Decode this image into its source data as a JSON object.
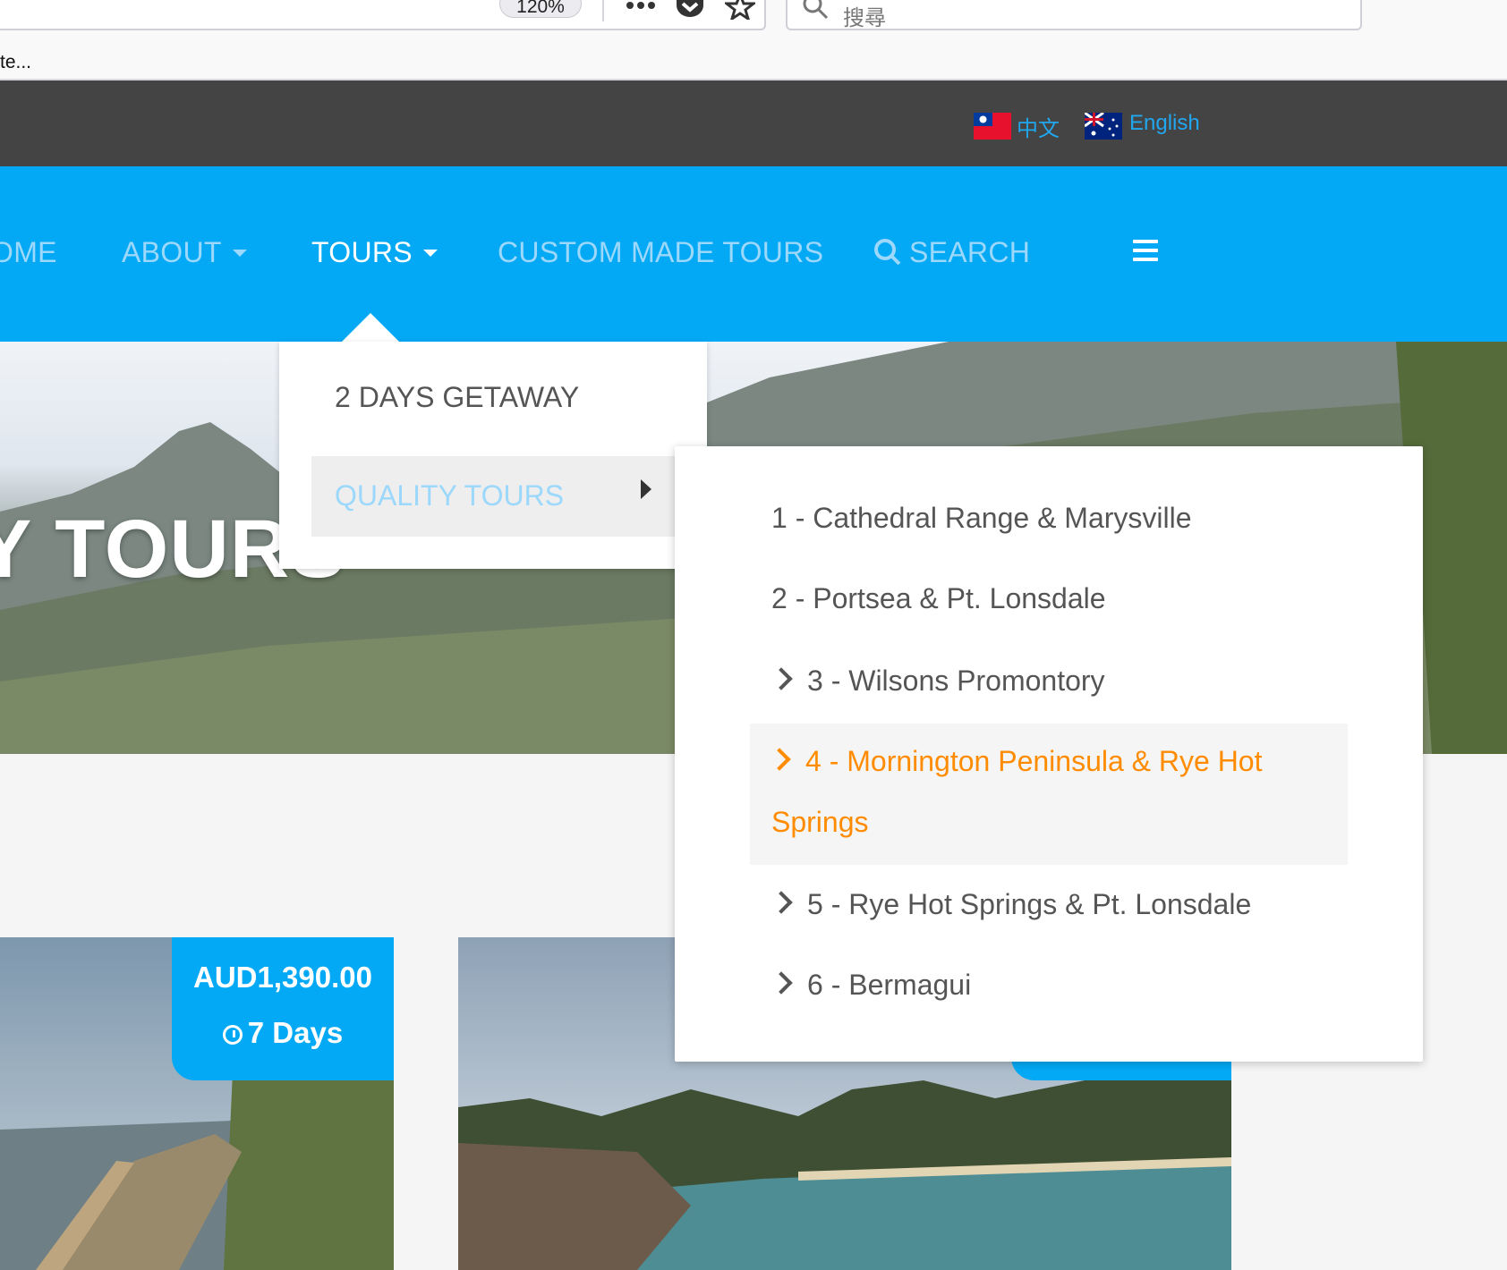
{
  "browser": {
    "zoom": "120%",
    "search_placeholder": "搜尋",
    "bookmark_label": "te..."
  },
  "lang_bar": {
    "chinese_label": "中文",
    "english_label": "English"
  },
  "nav": {
    "home": "OME",
    "about": "ABOUT",
    "tours": "TOURS",
    "custom": "CUSTOM MADE TOURS",
    "search": "SEARCH"
  },
  "hero": {
    "title": "Y TOURS"
  },
  "dropdown": {
    "item1": "2 DAYS GETAWAY",
    "item2": "QUALITY TOURS"
  },
  "submenu": {
    "items": [
      "1 - Cathedral Range & Marysville",
      "2 - Portsea & Pt. Lonsdale",
      "3 - Wilsons Promontory",
      "4 - Mornington Peninsula & Rye Hot Springs",
      "5 - Rye Hot Springs & Pt. Lonsdale",
      "6 - Bermagui"
    ]
  },
  "card1": {
    "price": "AUD1,390.00",
    "duration": "7 Days"
  },
  "colors": {
    "nav_blue": "#03a9f4",
    "top_bar": "#444444",
    "highlight_orange": "#ff8c00"
  }
}
